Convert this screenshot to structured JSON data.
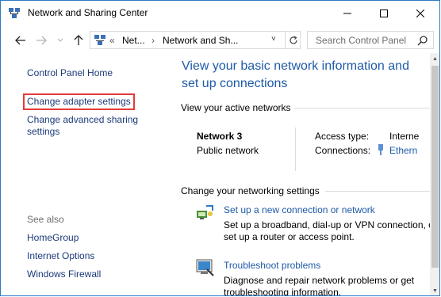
{
  "window": {
    "title": "Network and Sharing Center"
  },
  "address": {
    "crumb_sep": "«",
    "crumb1": "Net...",
    "crumb_arrow": "›",
    "crumb2": "Network and Sh...",
    "dropdown": "˅"
  },
  "search": {
    "placeholder": "Search Control Panel"
  },
  "left": {
    "home": "Control Panel Home",
    "adapter": "Change adapter settings",
    "advanced_line1": "Change advanced sharing",
    "advanced_line2": "settings",
    "see_also": "See also",
    "homegroup": "HomeGroup",
    "internet_options": "Internet Options",
    "firewall": "Windows Firewall"
  },
  "main": {
    "title_line1": "View your basic network information and",
    "title_line2": "set up connections",
    "active_header": "View your active networks",
    "network_name": "Network  3",
    "network_type": "Public network",
    "access_type_label": "Access type:",
    "access_type_value": "Interne",
    "connections_label": "Connections:",
    "connections_value": "Ethern",
    "change_header": "Change your networking settings",
    "task1_link": "Set up a new connection or network",
    "task1_desc": "Set up a broadband, dial-up or VPN connection, or set up a router or access point.",
    "task2_link": "Troubleshoot problems",
    "task2_desc": "Diagnose and repair network problems or get troubleshooting information."
  },
  "colors": {
    "link": "#1e5aa8",
    "highlight": "#e43a3a",
    "border": "#2b79c6"
  }
}
